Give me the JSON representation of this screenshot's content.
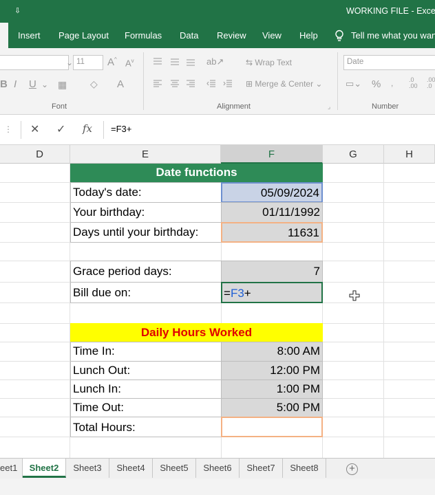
{
  "window": {
    "quick_access": "⇩",
    "title": "WORKING FILE  -  Exce"
  },
  "tabs": [
    "Insert",
    "Page Layout",
    "Formulas",
    "Data",
    "Review",
    "View",
    "Help",
    "Tell me what you wan"
  ],
  "ribbon": {
    "font_size": "11",
    "number_format": "Date",
    "wrap_text": "Wrap Text",
    "merge_center": "Merge & Center",
    "groups": {
      "font": "Font",
      "alignment": "Alignment",
      "number": "Number"
    }
  },
  "formula_bar": {
    "cancel": "✕",
    "enter": "✓",
    "fx": "fx",
    "content": "=F3+"
  },
  "columns": [
    "D",
    "E",
    "F",
    "G",
    "H"
  ],
  "date_section": {
    "header": "Date functions",
    "rows": [
      {
        "label": "Today's date:",
        "value": "05/09/2024"
      },
      {
        "label": "Your birthday:",
        "value": "01/11/1992"
      },
      {
        "label": "Days until your birthday:",
        "value": "11631"
      }
    ],
    "grace": {
      "label": "Grace period days:",
      "value": "7"
    },
    "bill": {
      "label": "Bill due on:",
      "formula_eq": "=",
      "formula_ref": "F3",
      "formula_op": "+"
    }
  },
  "hours_section": {
    "header": "Daily Hours Worked",
    "rows": [
      {
        "label": "Time In:",
        "value": "8:00 AM"
      },
      {
        "label": "Lunch Out:",
        "value": "12:00 PM"
      },
      {
        "label": "Lunch In:",
        "value": "1:00 PM"
      },
      {
        "label": "Time Out:",
        "value": "5:00 PM"
      },
      {
        "label": "Total Hours:",
        "value": ""
      }
    ]
  },
  "sheets": [
    "eet1",
    "Sheet2",
    "Sheet3",
    "Sheet4",
    "Sheet5",
    "Sheet6",
    "Sheet7",
    "Sheet8"
  ],
  "active_sheet": "Sheet2",
  "add_sheet": "+",
  "colors": {
    "excel_green": "#217346",
    "header_green": "#2e8b57",
    "header_yellow": "#ffff00",
    "header_red_text": "#e00000",
    "ref_blue": "#1f5fd6",
    "active_border": "#f4b183"
  }
}
